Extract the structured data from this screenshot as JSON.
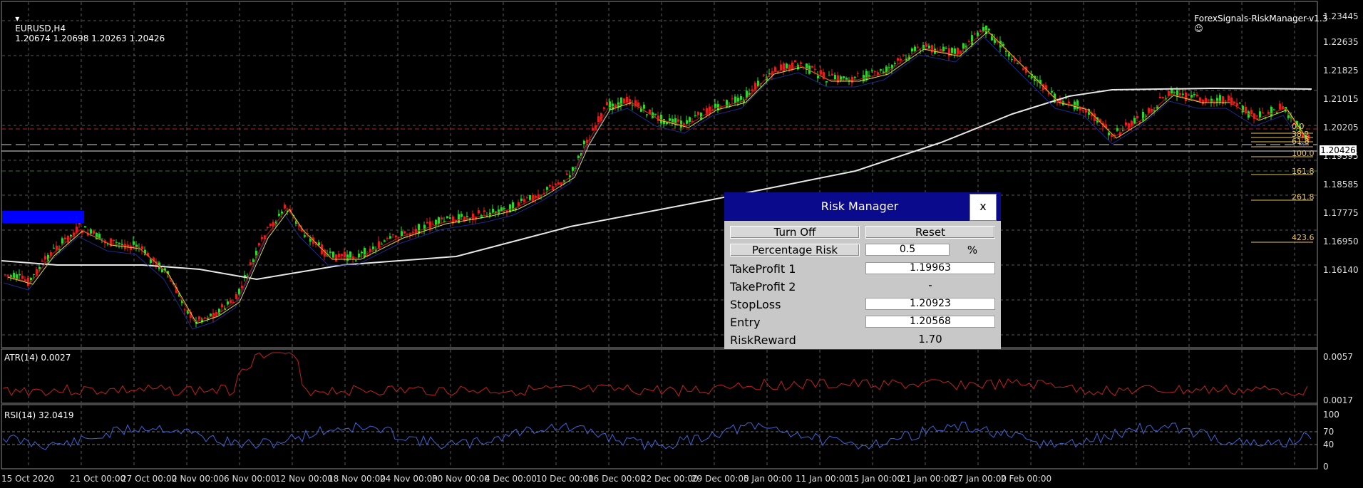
{
  "chart": {
    "symbol_header": "EURUSD,H4",
    "ohlc": "1.20674 1.20698 1.20263 1.20426",
    "expert_name": "ForexSignals-RiskManager-v1.3",
    "current_price": "1.20426",
    "price_scale": [
      "1.23445",
      "1.22635",
      "1.21825",
      "1.21015",
      "1.20205",
      "1.19395",
      "1.18585",
      "1.17775",
      "1.16950",
      "1.16140"
    ],
    "date_labels": [
      "15 Oct 2020",
      "21 Oct 00:00",
      "27 Oct 00:00",
      "2 Nov 00:00",
      "6 Nov 00:00",
      "12 Nov 00:00",
      "18 Nov 00:00",
      "24 Nov 00:00",
      "30 Nov 00:00",
      "4 Dec 00:00",
      "10 Dec 00:00",
      "16 Dec 00:00",
      "22 Dec 00:00",
      "29 Dec 00:00",
      "5 Jan 00:00",
      "11 Jan 00:00",
      "15 Jan 00:00",
      "21 Jan 00:00",
      "27 Jan 00:00",
      "2 Feb 00:00"
    ],
    "fib_levels": [
      "0.0",
      "38.2",
      "61.8",
      "100.0",
      "161.8",
      "261.8",
      "423.6"
    ],
    "colors": {
      "bull": "#27d827",
      "bear": "#e01e1e",
      "grid": "#5a5a5a",
      "ma_slow": "#e6e6e6",
      "ma_mid": "#1c2a8c",
      "ma_fast_yellow": "#d8d84a",
      "ma_fast_red": "#c01818",
      "atr": "#c42121",
      "rsi": "#3f63d6",
      "fib": "#e6c35a",
      "panel_title": "#0a0a8c",
      "marker": "#0000ff"
    }
  },
  "indicators": {
    "atr": {
      "label": "ATR(14) 0.0027",
      "scale": [
        "0.0057",
        "0.0017"
      ]
    },
    "rsi": {
      "label": "RSI(14) 32.0419",
      "scale": [
        "100",
        "70",
        "40",
        "0"
      ]
    }
  },
  "risk_manager": {
    "title": "Risk Manager",
    "close_label": "x",
    "turn_off_label": "Turn Off",
    "reset_label": "Reset",
    "percentage_risk_label": "Percentage Risk",
    "percentage_risk_value": "0.5",
    "percent_sign": "%",
    "takeprofit1_label": "TakeProfit 1",
    "takeprofit1_value": "1.19963",
    "takeprofit2_label": "TakeProfit 2",
    "takeprofit2_value": "-",
    "stoploss_label": "StopLoss",
    "stoploss_value": "1.20923",
    "entry_label": "Entry",
    "entry_value": "1.20568",
    "riskreward_label": "RiskReward",
    "riskreward_value": "1.70"
  }
}
